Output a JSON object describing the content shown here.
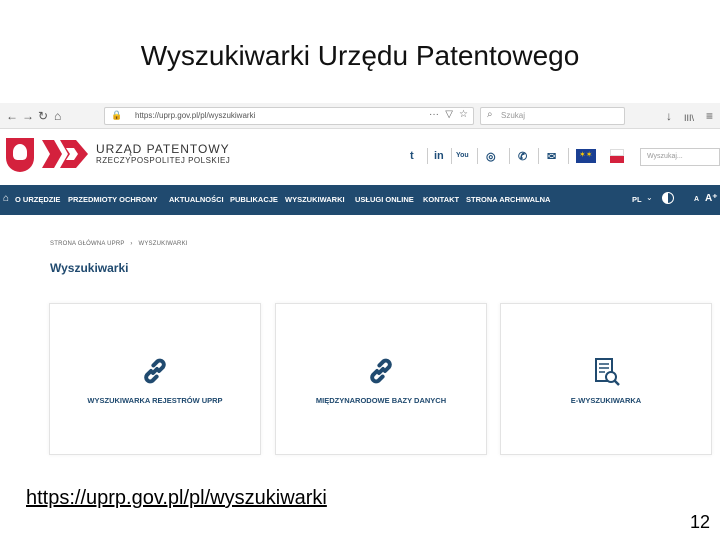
{
  "slide": {
    "title": "Wyszukiwarki Urzędu Patentowego",
    "link": "https://uprp.gov.pl/pl/wyszukiwarki",
    "page_number": "12"
  },
  "browser": {
    "back_icon": "←",
    "forward_icon": "→",
    "reload_icon": "↻",
    "home_icon": "⌂",
    "url": "https://uprp.gov.pl/pl/wyszukiwarki",
    "more_icon": "···",
    "search_placeholder": "Szukaj",
    "download_icon": "↓",
    "library_icon": "III\\",
    "menu_icon": "≡"
  },
  "site": {
    "logo_line1": "URZĄD PATENTOWY",
    "logo_line2": "RZECZYPOSPOLITEJ POLSKIEJ",
    "search_placeholder": "Wyszukaj...",
    "social": [
      "t",
      "in",
      "You",
      "◎",
      "✆",
      "✉"
    ],
    "nav": [
      "O URZĘDZIE",
      "PRZEDMIOTY OCHRONY",
      "AKTUALNOŚCI",
      "PUBLIKACJE",
      "WYSZUKIWARKI",
      "USŁUGI ONLINE",
      "KONTAKT",
      "STRONA ARCHIWALNA"
    ],
    "lang": "PL",
    "font_small": "A",
    "font_large": "A⁺"
  },
  "content": {
    "breadcrumb_home": "STRONA GŁÓWNA UPRP",
    "breadcrumb_current": "WYSZUKIWARKI",
    "title": "Wyszukiwarki",
    "cards": [
      {
        "label": "WYSZUKIWARKA REJESTRÓW UPRP",
        "icon": "link-icon"
      },
      {
        "label": "MIĘDZYNARODOWE BAZY DANYCH",
        "icon": "link-icon"
      },
      {
        "label": "E-WYSZUKIWARKA",
        "icon": "document-search-icon"
      }
    ]
  },
  "colors": {
    "nav_bg": "#204a6f",
    "accent": "#204a6f",
    "brand_red": "#d4213d"
  }
}
